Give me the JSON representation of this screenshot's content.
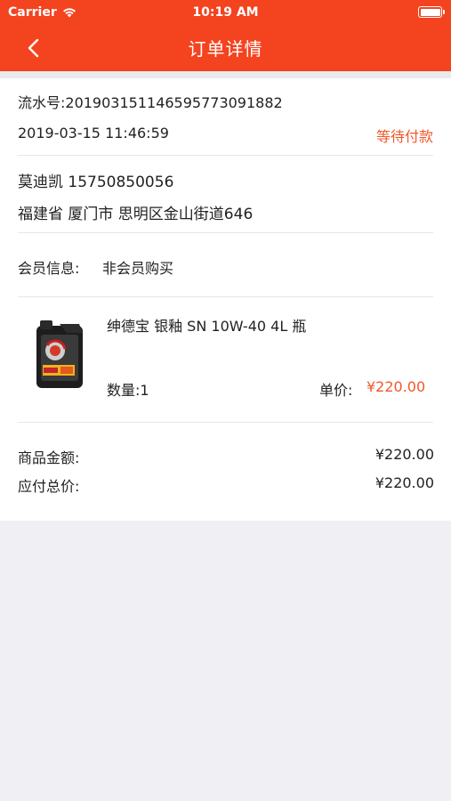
{
  "status_bar": {
    "carrier": "Carrier",
    "time": "10:19 AM"
  },
  "nav": {
    "title": "订单详情"
  },
  "order": {
    "serial": "流水号:20190315114659577309188​2",
    "datetime": "2019-03-15 11:46:59",
    "status": "等待付款"
  },
  "contact": {
    "name_phone": "莫迪凯   15750850056",
    "address": "福建省 厦门市 思明区金山街道646"
  },
  "member": {
    "label": "会员信息:",
    "value": "非会员购买"
  },
  "product": {
    "name": "绅德宝 银釉 SN 10W-40 4L 瓶",
    "quantity": "数量:1",
    "unit_price_label": "单价:",
    "unit_price": "¥220.00"
  },
  "summary": {
    "goods_amount_label": "商品金额:",
    "goods_amount": "¥220.00",
    "total_label": "应付总价:",
    "total": "¥220.00"
  },
  "colors": {
    "accent": "#f4431f",
    "status": "#f0582a"
  },
  "icons": [
    "wifi-icon",
    "battery-icon",
    "chevron-left-icon",
    "oil-bottle-image"
  ]
}
